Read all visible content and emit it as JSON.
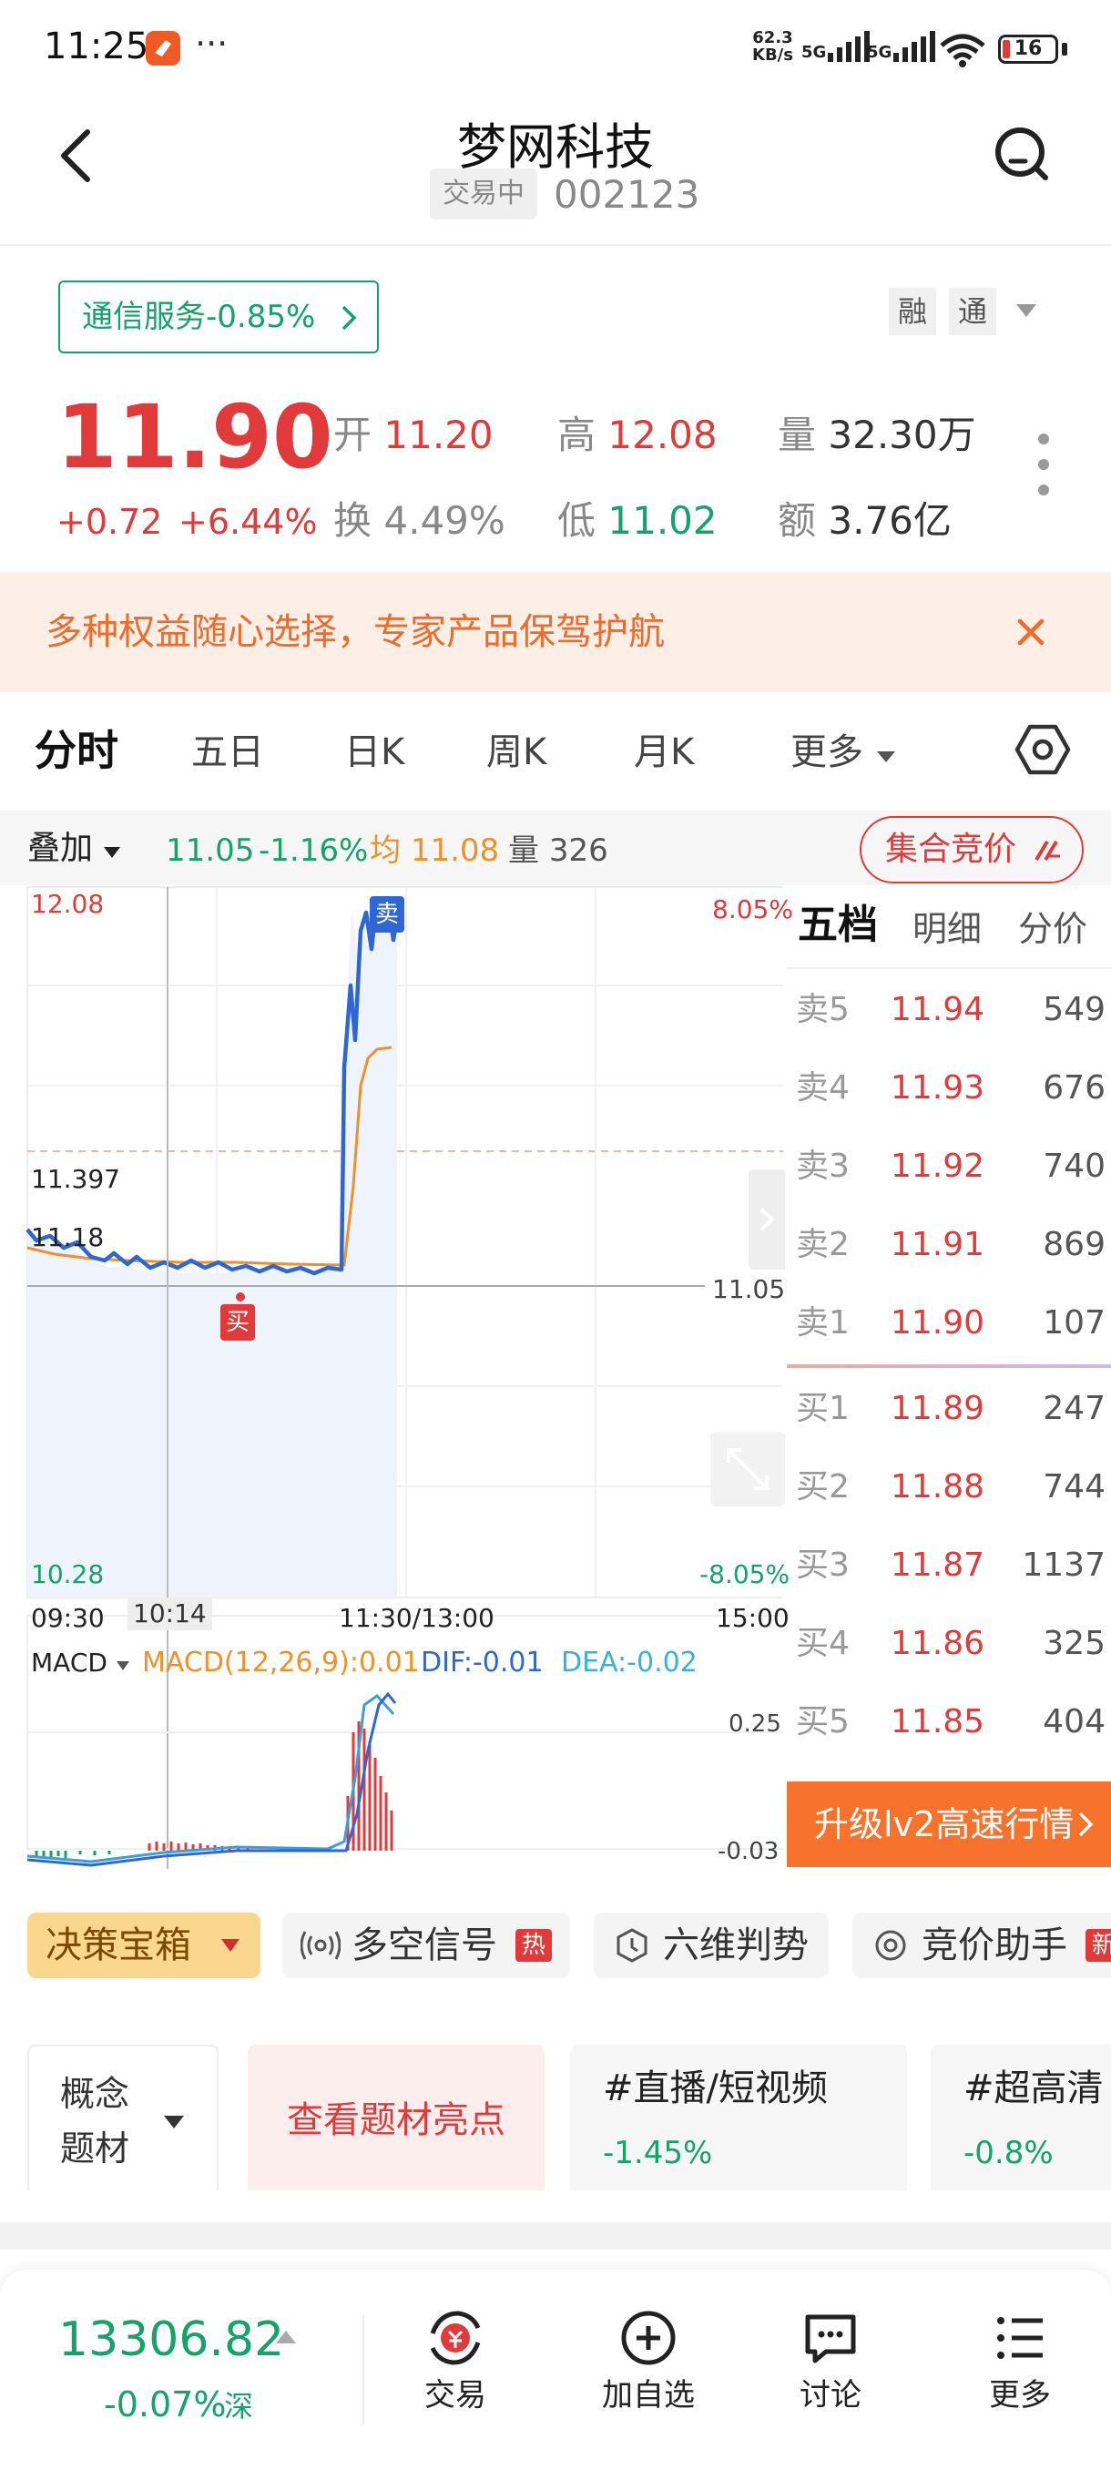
{
  "status_bar": {
    "time": "11:25",
    "more": "···",
    "net_speed_value": "62.3",
    "net_speed_unit": "KB/s",
    "sig1": "5G",
    "sig2": "5G",
    "battery": "16"
  },
  "header": {
    "title": "梦网科技",
    "status_badge": "交易中",
    "code": "002123"
  },
  "sector": {
    "label": "通信服务",
    "change": "-0.85%"
  },
  "tags": {
    "rong": "融",
    "tong": "通"
  },
  "quote": {
    "price": "11.90",
    "change": "+0.72",
    "change_pct": "+6.44%",
    "open_label": "开",
    "open": "11.20",
    "high_label": "高",
    "high": "12.08",
    "volume_label": "量",
    "volume": "32.30万",
    "turnover_label": "换",
    "turnover": "4.49%",
    "low_label": "低",
    "low": "11.02",
    "amount_label": "额",
    "amount": "3.76亿"
  },
  "banner": {
    "text": "多种权益随心选择，专家产品保驾护航"
  },
  "tabs": [
    "分时",
    "五日",
    "日K",
    "周K",
    "月K",
    "更多"
  ],
  "chart_bar": {
    "overlay": "叠加",
    "price": "11.05",
    "pct": "-1.16%",
    "avg_label": "均",
    "avg": "11.08",
    "vol_label": "量",
    "vol": "326",
    "auction": "集合竞价"
  },
  "chart": {
    "y_max": "12.08",
    "y_mark": "11.397",
    "y_prev": "11.18",
    "y_min": "10.28",
    "pct_max": "8.05%",
    "pct_min": "-8.05%",
    "cross_price": "11.05",
    "times": [
      "09:30",
      "10:14",
      "11:30/13:00",
      "15:00"
    ],
    "sell_marker": "卖",
    "buy_marker": "买"
  },
  "macd": {
    "label": "MACD",
    "params": "MACD(12,26,9):0.01",
    "dif": "DIF:-0.01",
    "dea": "DEA:-0.02",
    "y_top": "0.25",
    "y_bottom": "-0.03"
  },
  "order_book": {
    "tabs": [
      "五档",
      "明细",
      "分价"
    ],
    "asks": [
      {
        "label": "卖5",
        "price": "11.94",
        "vol": "549"
      },
      {
        "label": "卖4",
        "price": "11.93",
        "vol": "676"
      },
      {
        "label": "卖3",
        "price": "11.92",
        "vol": "740"
      },
      {
        "label": "卖2",
        "price": "11.91",
        "vol": "869"
      },
      {
        "label": "卖1",
        "price": "11.90",
        "vol": "107"
      }
    ],
    "bids": [
      {
        "label": "买1",
        "price": "11.89",
        "vol": "247"
      },
      {
        "label": "买2",
        "price": "11.88",
        "vol": "744"
      },
      {
        "label": "买3",
        "price": "11.87",
        "vol": "1137"
      },
      {
        "label": "买4",
        "price": "11.86",
        "vol": "325"
      },
      {
        "label": "买5",
        "price": "11.85",
        "vol": "404"
      }
    ],
    "upgrade": "升级lv2高速行情"
  },
  "tools": [
    {
      "label": "决策宝箱"
    },
    {
      "label": "多空信号",
      "badge": "热"
    },
    {
      "label": "六维判势"
    },
    {
      "label": "竞价助手",
      "badge": "新"
    }
  ],
  "themes": {
    "selector": "概念题材",
    "highlight": "查看题材亮点",
    "items": [
      {
        "name": "#直播/短视频",
        "change": "-1.45%"
      },
      {
        "name": "#超高清",
        "change": "-0.8%"
      }
    ]
  },
  "bottom": {
    "index_value": "13306.82",
    "index_change": "-0.07%",
    "index_market": "深",
    "buttons": [
      "交易",
      "加自选",
      "讨论",
      "更多"
    ]
  },
  "colors": {
    "up": "#e03a3a",
    "down": "#15a26b",
    "price_line": "#2f66d6",
    "avg_line": "#f0902a",
    "accent": "#f7732d"
  }
}
